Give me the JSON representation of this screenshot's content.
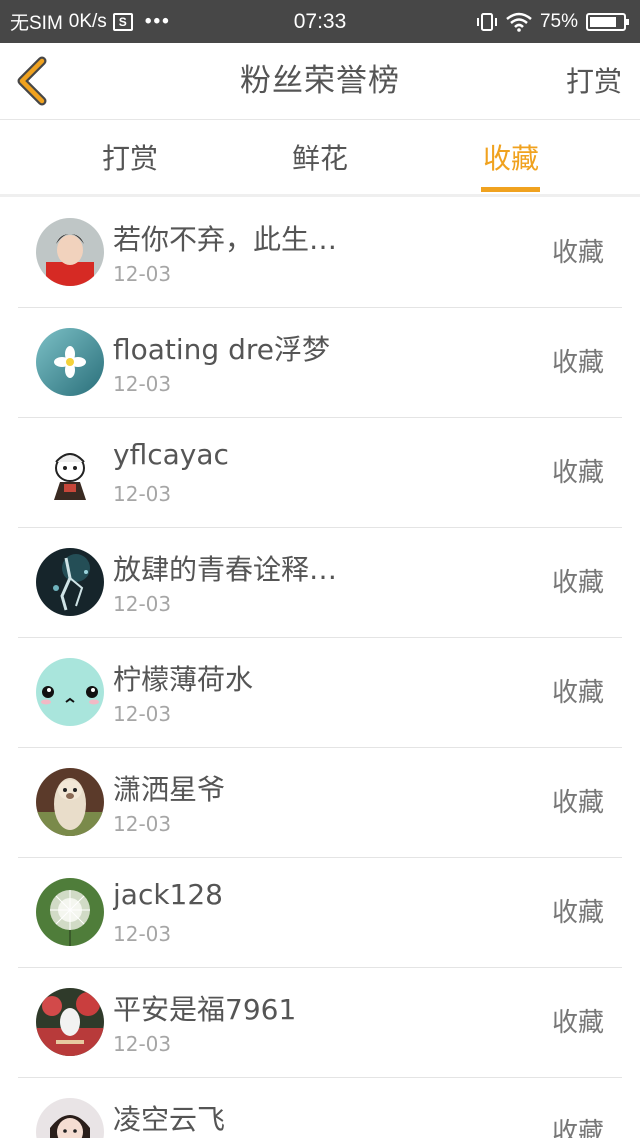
{
  "status_bar": {
    "carrier": "无SIM",
    "speed": "0K/s",
    "sim_icon_glyph": "S",
    "dots": "•••",
    "time": "07:33",
    "battery": "75%",
    "icons": [
      "vibrate-icon",
      "wifi-icon",
      "battery-icon"
    ]
  },
  "header": {
    "title": "粉丝荣誉榜",
    "action": "打赏",
    "back_icon": "chevron-left-icon",
    "back_color": "#f0a21f"
  },
  "tabs": [
    {
      "label": "打赏",
      "active": false
    },
    {
      "label": "鲜花",
      "active": false
    },
    {
      "label": "收藏",
      "active": true
    }
  ],
  "accent_color": "#f0a21f",
  "list": [
    {
      "name": "若你不弃，此生…",
      "date": "12-03",
      "action": "收藏",
      "avatar": "avatar-person-red"
    },
    {
      "name": "floating dre浮梦",
      "date": "12-03",
      "action": "收藏",
      "avatar": "avatar-flower-water"
    },
    {
      "name": "yflcayac",
      "date": "12-03",
      "action": "收藏",
      "avatar": "avatar-cartoon-boy"
    },
    {
      "name": "放肆的青春诠释…",
      "date": "12-03",
      "action": "收藏",
      "avatar": "avatar-dark-art"
    },
    {
      "name": "柠檬薄荷水",
      "date": "12-03",
      "action": "收藏",
      "avatar": "avatar-cute-face"
    },
    {
      "name": "潇洒星爷",
      "date": "12-03",
      "action": "收藏",
      "avatar": "avatar-alpaca"
    },
    {
      "name": "jack128",
      "date": "12-03",
      "action": "收藏",
      "avatar": "avatar-dandelion"
    },
    {
      "name": "平安是福7961",
      "date": "12-03",
      "action": "收藏",
      "avatar": "avatar-garden"
    },
    {
      "name": "凌空云飞",
      "date": "",
      "action": "收藏",
      "avatar": "avatar-girl"
    }
  ]
}
